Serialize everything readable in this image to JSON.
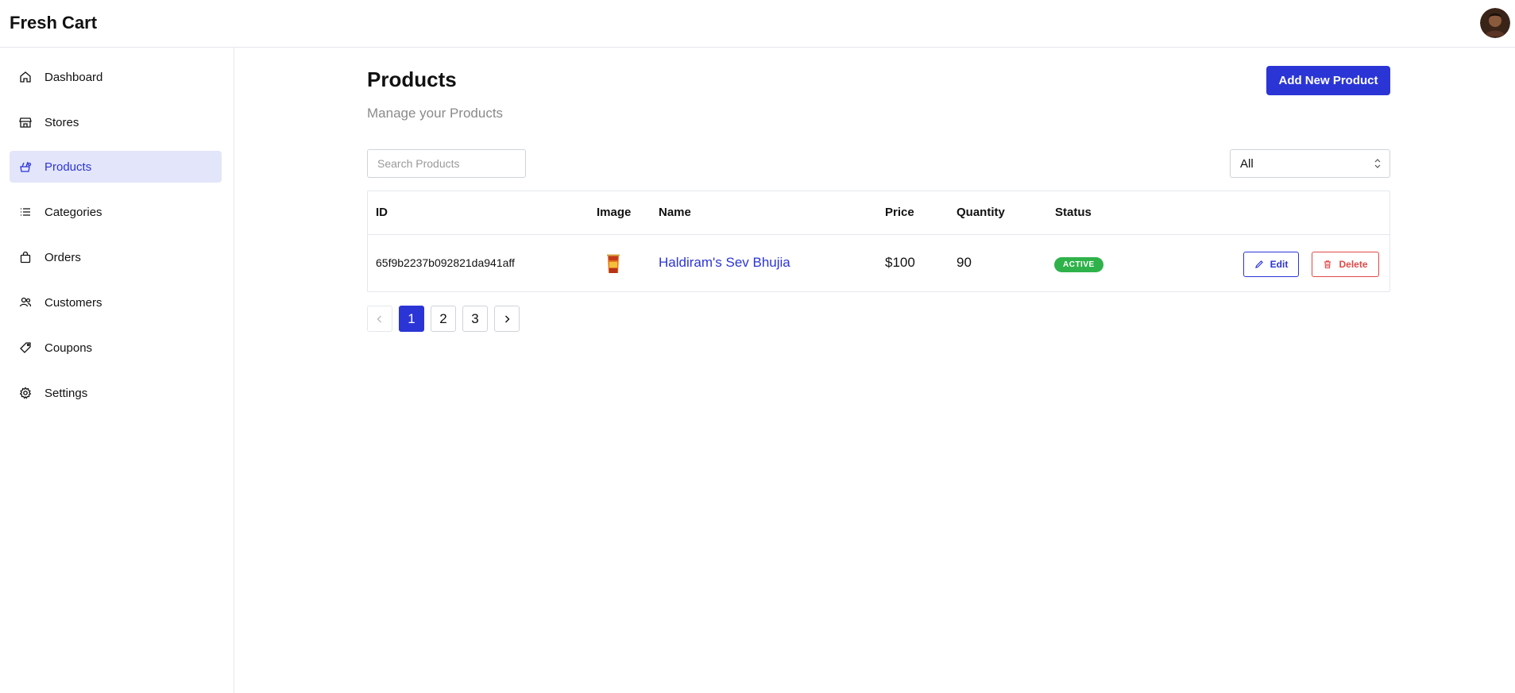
{
  "app": {
    "brand": "Fresh Cart"
  },
  "sidebar": {
    "items": [
      {
        "label": "Dashboard",
        "icon": "home-icon"
      },
      {
        "label": "Stores",
        "icon": "store-icon"
      },
      {
        "label": "Products",
        "icon": "product-icon",
        "active": true
      },
      {
        "label": "Categories",
        "icon": "list-icon"
      },
      {
        "label": "Orders",
        "icon": "bag-icon"
      },
      {
        "label": "Customers",
        "icon": "users-icon"
      },
      {
        "label": "Coupons",
        "icon": "tag-icon"
      },
      {
        "label": "Settings",
        "icon": "gear-icon"
      }
    ]
  },
  "page": {
    "title": "Products",
    "subtitle": "Manage your Products",
    "add_button": "Add New Product"
  },
  "toolbar": {
    "search_placeholder": "Search Products",
    "filter_value": "All"
  },
  "table": {
    "columns": [
      "ID",
      "Image",
      "Name",
      "Price",
      "Quantity",
      "Status"
    ],
    "rows": [
      {
        "id": "65f9b2237b092821da941aff",
        "name": "Haldiram's Sev Bhujia",
        "price": "$100",
        "quantity": "90",
        "status": "ACTIVE",
        "edit_label": "Edit",
        "delete_label": "Delete"
      }
    ]
  },
  "pagination": {
    "pages": [
      "1",
      "2",
      "3"
    ],
    "current": "1"
  },
  "colors": {
    "accent": "#2b35d6",
    "active_nav_bg": "#e3e5fb",
    "status_active": "#2fb24a",
    "danger": "#e04848"
  }
}
